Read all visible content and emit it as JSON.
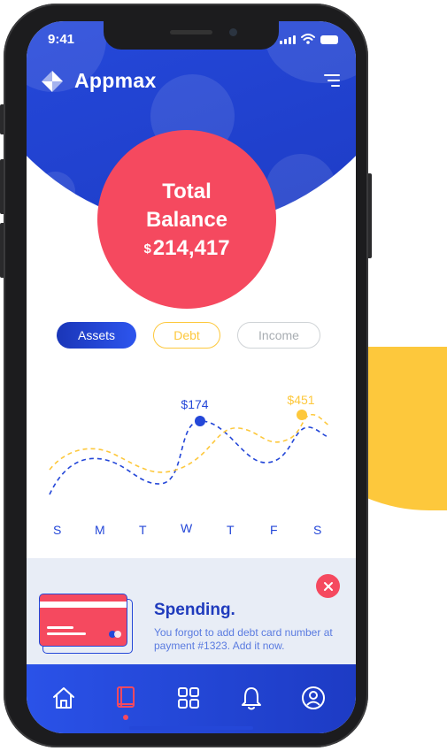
{
  "status_bar": {
    "time": "9:41"
  },
  "app": {
    "name": "Appmax"
  },
  "balance": {
    "title": "Total Balance",
    "currency": "$",
    "amount": "214,417"
  },
  "tabs": [
    {
      "label": "Assets",
      "active": true
    },
    {
      "label": "Debt",
      "active": false
    },
    {
      "label": "Income",
      "active": false
    }
  ],
  "chart_data": {
    "type": "line",
    "categories": [
      "S",
      "M",
      "T",
      "W",
      "T",
      "F",
      "S"
    ],
    "series": [
      {
        "color": "#2447d8",
        "style": "dashed",
        "highlight_label": "$174"
      },
      {
        "color": "#fdc83c",
        "style": "dashed",
        "highlight_label": "$451"
      }
    ],
    "annotations": [
      "$174",
      "$451"
    ],
    "grid": false
  },
  "notice": {
    "title": "Spending.",
    "text": "You forgot to add debt card number at payment #1323. Add it now."
  },
  "nav": [
    {
      "icon": "home-icon"
    },
    {
      "icon": "book-icon",
      "active": true
    },
    {
      "icon": "grid-icon"
    },
    {
      "icon": "bell-icon"
    },
    {
      "icon": "user-icon"
    }
  ],
  "colors": {
    "primary": "#2447d8",
    "accent": "#f5495f",
    "yellow": "#fdc83c"
  }
}
